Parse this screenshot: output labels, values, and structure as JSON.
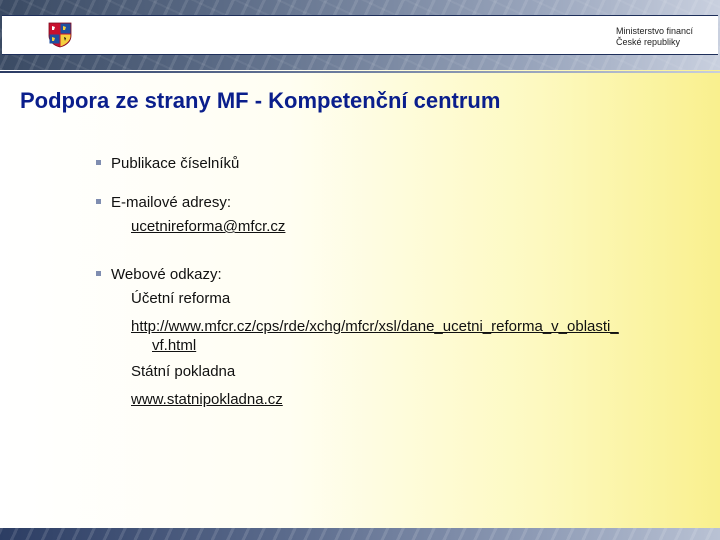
{
  "header": {
    "ministry_line1": "Ministerstvo financí",
    "ministry_line2": "České republiky",
    "emblem_icon": "czech-coat-of-arms-icon"
  },
  "slide": {
    "title": "Podpora ze strany MF - Kompetenční centrum",
    "bullets": [
      {
        "label": "Publikace číselníků"
      },
      {
        "label": "E-mailové adresy:",
        "email": "ucetnireforma@mfcr.cz"
      },
      {
        "label": "Webové odkazy:",
        "items": [
          {
            "name": "Účetní reforma"
          },
          {
            "url_line1": "http://www.mfcr.cz/cps/rde/xchg/mfcr/xsl/dane_ucetni_reforma_v_oblasti_",
            "url_line2": "vf.html"
          },
          {
            "name": "Státní pokladna"
          },
          {
            "url": "www.statnipokladna.cz"
          }
        ]
      }
    ]
  },
  "colors": {
    "title": "#0a1e8c",
    "banner": "#3a4a63",
    "background_end": "#f9f08e"
  }
}
